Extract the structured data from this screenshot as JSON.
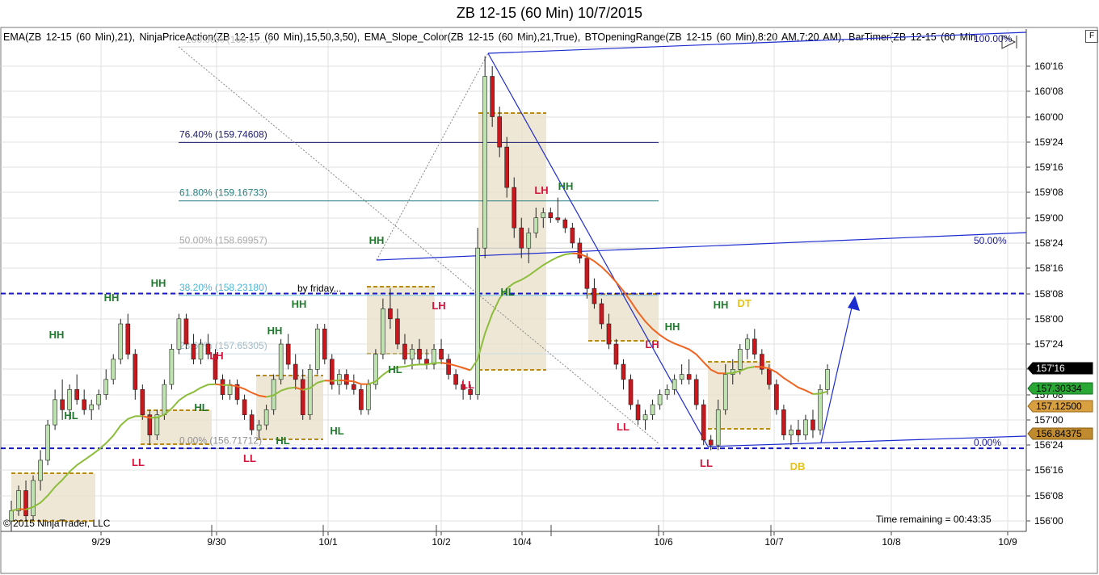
{
  "window": {
    "title": "ZB 12-15 (60 Min)  10/7/2015",
    "indicators_line": "EMA(ZB  12-15  (60  Min),21),  NinjaPriceAction(ZB  12-15  (60  Min),15,50,3,50),  EMA_Slope_Color(ZB  12-15  (60  Min),21,True),  BTOpeningRange(ZB  12-15  (60  Min),8:20  AM,7:20  AM),  BarTimer(ZB  12-15  (60  Min",
    "f_button": "F",
    "copyright": "© 2015 NinjaTrader, LLC",
    "time_remaining": "Time remaining = 00:43:35"
  },
  "colors": {
    "up_candle": "#bfe3b0",
    "down_candle": "#c8181e",
    "ema_green": "#8cbd3a",
    "ema_orange": "#ee6420",
    "channel_blue": "#1c2bd0",
    "dashed_level": "#1414c8",
    "range_fill": "#eadfc8",
    "range_border": "#b88a1a",
    "hh_label": "#1f7a2e",
    "ll_label": "#d4143c",
    "dt_label": "#e6c21a"
  },
  "chart_data": {
    "type": "candlestick",
    "symbol": "ZB 12-15",
    "interval": "60 Min",
    "y_range_ticks": [
      156.0,
      158.5625
    ],
    "x_ticks": [
      "9/29",
      "9/30",
      "10/1",
      "10/2",
      "10/4",
      "10/6",
      "10/7",
      "10/8",
      "10/9"
    ],
    "y_ticks": [
      "160'16",
      "160'08",
      "160'00",
      "159'24",
      "159'16",
      "159'08",
      "159'00",
      "158'24",
      "158'16",
      "158'08",
      "158'00",
      "157'24",
      "157'16",
      "157'08",
      "157'00",
      "156'24",
      "156'16",
      "156'08",
      "156'00"
    ],
    "price_badges": [
      {
        "label": "157'16",
        "style": "last"
      },
      {
        "label": "157.30334",
        "style": "ema"
      },
      {
        "label": "157.12500",
        "style": "range_high"
      },
      {
        "label": "156.84375",
        "style": "range_low"
      }
    ],
    "fibonacci_levels": [
      {
        "label": "76.40% (159.74608)",
        "value": 159.74608
      },
      {
        "label": "61.80% (159.16733)",
        "value": 159.16733
      },
      {
        "label": "50.00% (158.69957)",
        "value": 158.69957
      },
      {
        "label": "38.20% (158.23180)",
        "value": 158.2318
      },
      {
        "label": "23.60% (157.65305)",
        "value": 157.65305
      },
      {
        "label": "0.00% (156.71712)",
        "value": 156.71712
      },
      {
        "label": "100.00% (160.67...)",
        "value": 160.67
      }
    ],
    "channel_labels": [
      "100.00%",
      "50.00%",
      "0.00%"
    ],
    "dashed_levels": [
      158.25,
      156.71875
    ],
    "annotation": "by friday...",
    "swing_labels": [
      {
        "text": "HH",
        "kind": "hh"
      },
      {
        "text": "HL",
        "kind": "hh"
      },
      {
        "text": "LL",
        "kind": "ll"
      },
      {
        "text": "HH",
        "kind": "hh"
      },
      {
        "text": "HH",
        "kind": "hh"
      },
      {
        "text": "HL",
        "kind": "hh"
      },
      {
        "text": "LH",
        "kind": "ll"
      },
      {
        "text": "LL",
        "kind": "ll"
      },
      {
        "text": "HH",
        "kind": "hh"
      },
      {
        "text": "HH",
        "kind": "hh"
      },
      {
        "text": "HL",
        "kind": "hh"
      },
      {
        "text": "HL",
        "kind": "hh"
      },
      {
        "text": "HH",
        "kind": "hh"
      },
      {
        "text": "HL",
        "kind": "hh"
      },
      {
        "text": "LH",
        "kind": "ll"
      },
      {
        "text": "LL",
        "kind": "ll"
      },
      {
        "text": "LH",
        "kind": "ll"
      },
      {
        "text": "HH",
        "kind": "hh"
      },
      {
        "text": "HL",
        "kind": "hh"
      },
      {
        "text": "LL",
        "kind": "ll"
      },
      {
        "text": "HH",
        "kind": "hh"
      },
      {
        "text": "LH",
        "kind": "ll"
      },
      {
        "text": "LL",
        "kind": "ll"
      },
      {
        "text": "HH",
        "kind": "hh"
      },
      {
        "text": "DT",
        "kind": "dt"
      },
      {
        "text": "DB",
        "kind": "dt"
      }
    ],
    "candles": [
      {
        "o": 156.0,
        "h": 156.2,
        "l": 155.9,
        "c": 156.1
      },
      {
        "o": 156.1,
        "h": 156.35,
        "l": 156.05,
        "c": 156.3
      },
      {
        "o": 156.3,
        "h": 156.4,
        "l": 156.0,
        "c": 156.05
      },
      {
        "o": 156.05,
        "h": 156.45,
        "l": 156.0,
        "c": 156.4
      },
      {
        "o": 156.4,
        "h": 156.7,
        "l": 156.3,
        "c": 156.6
      },
      {
        "o": 156.6,
        "h": 157.0,
        "l": 156.55,
        "c": 156.95
      },
      {
        "o": 156.95,
        "h": 157.3,
        "l": 156.9,
        "c": 157.2
      },
      {
        "o": 157.2,
        "h": 157.4,
        "l": 157.0,
        "c": 157.1
      },
      {
        "o": 157.1,
        "h": 157.35,
        "l": 157.0,
        "c": 157.3
      },
      {
        "o": 157.3,
        "h": 157.45,
        "l": 157.15,
        "c": 157.2
      },
      {
        "o": 157.2,
        "h": 157.3,
        "l": 157.05,
        "c": 157.1
      },
      {
        "o": 157.1,
        "h": 157.2,
        "l": 157.0,
        "c": 157.15
      },
      {
        "o": 157.15,
        "h": 157.3,
        "l": 157.1,
        "c": 157.25
      },
      {
        "o": 157.25,
        "h": 157.5,
        "l": 157.2,
        "c": 157.4
      },
      {
        "o": 157.4,
        "h": 157.65,
        "l": 157.35,
        "c": 157.6
      },
      {
        "o": 157.6,
        "h": 158.0,
        "l": 157.55,
        "c": 157.95
      },
      {
        "o": 157.95,
        "h": 158.05,
        "l": 157.6,
        "c": 157.65
      },
      {
        "o": 157.65,
        "h": 157.7,
        "l": 157.2,
        "c": 157.3
      },
      {
        "o": 157.3,
        "h": 157.35,
        "l": 157.0,
        "c": 157.05
      },
      {
        "o": 157.05,
        "h": 157.1,
        "l": 156.75,
        "c": 156.85
      },
      {
        "o": 156.85,
        "h": 157.1,
        "l": 156.8,
        "c": 157.05
      },
      {
        "o": 157.05,
        "h": 157.4,
        "l": 157.0,
        "c": 157.35
      },
      {
        "o": 157.35,
        "h": 157.75,
        "l": 157.3,
        "c": 157.7
      },
      {
        "o": 157.7,
        "h": 158.05,
        "l": 157.65,
        "c": 158.0
      },
      {
        "o": 158.0,
        "h": 158.05,
        "l": 157.7,
        "c": 157.75
      },
      {
        "o": 157.75,
        "h": 157.85,
        "l": 157.55,
        "c": 157.6
      },
      {
        "o": 157.6,
        "h": 157.8,
        "l": 157.55,
        "c": 157.75
      },
      {
        "o": 157.75,
        "h": 157.85,
        "l": 157.6,
        "c": 157.65
      },
      {
        "o": 157.65,
        "h": 157.7,
        "l": 157.35,
        "c": 157.4
      },
      {
        "o": 157.4,
        "h": 157.45,
        "l": 157.2,
        "c": 157.25
      },
      {
        "o": 157.25,
        "h": 157.4,
        "l": 157.2,
        "c": 157.35
      },
      {
        "o": 157.35,
        "h": 157.4,
        "l": 157.15,
        "c": 157.2
      },
      {
        "o": 157.2,
        "h": 157.25,
        "l": 157.0,
        "c": 157.05
      },
      {
        "o": 157.05,
        "h": 157.1,
        "l": 156.85,
        "c": 156.9
      },
      {
        "o": 156.9,
        "h": 157.0,
        "l": 156.82,
        "c": 156.95
      },
      {
        "o": 156.95,
        "h": 157.15,
        "l": 156.9,
        "c": 157.1
      },
      {
        "o": 157.1,
        "h": 157.45,
        "l": 157.05,
        "c": 157.4
      },
      {
        "o": 157.4,
        "h": 157.8,
        "l": 157.35,
        "c": 157.75
      },
      {
        "o": 157.75,
        "h": 157.85,
        "l": 157.5,
        "c": 157.55
      },
      {
        "o": 157.55,
        "h": 157.65,
        "l": 157.3,
        "c": 157.4
      },
      {
        "o": 157.4,
        "h": 157.5,
        "l": 157.0,
        "c": 157.05
      },
      {
        "o": 157.05,
        "h": 157.55,
        "l": 157.0,
        "c": 157.5
      },
      {
        "o": 157.5,
        "h": 157.95,
        "l": 157.45,
        "c": 157.9
      },
      {
        "o": 157.9,
        "h": 157.95,
        "l": 157.55,
        "c": 157.6
      },
      {
        "o": 157.6,
        "h": 157.65,
        "l": 157.3,
        "c": 157.35
      },
      {
        "o": 157.35,
        "h": 157.5,
        "l": 157.25,
        "c": 157.45
      },
      {
        "o": 157.45,
        "h": 157.5,
        "l": 157.3,
        "c": 157.35
      },
      {
        "o": 157.35,
        "h": 157.45,
        "l": 157.25,
        "c": 157.3
      },
      {
        "o": 157.3,
        "h": 157.35,
        "l": 157.05,
        "c": 157.1
      },
      {
        "o": 157.1,
        "h": 157.4,
        "l": 157.05,
        "c": 157.35
      },
      {
        "o": 157.35,
        "h": 157.7,
        "l": 157.3,
        "c": 157.65
      },
      {
        "o": 157.65,
        "h": 158.2,
        "l": 157.6,
        "c": 158.1
      },
      {
        "o": 158.1,
        "h": 158.3,
        "l": 157.9,
        "c": 158.0
      },
      {
        "o": 158.0,
        "h": 158.1,
        "l": 157.7,
        "c": 157.75
      },
      {
        "o": 157.75,
        "h": 157.85,
        "l": 157.55,
        "c": 157.6
      },
      {
        "o": 157.6,
        "h": 157.75,
        "l": 157.5,
        "c": 157.7
      },
      {
        "o": 157.7,
        "h": 157.8,
        "l": 157.55,
        "c": 157.6
      },
      {
        "o": 157.6,
        "h": 157.7,
        "l": 157.5,
        "c": 157.55
      },
      {
        "o": 157.55,
        "h": 157.75,
        "l": 157.5,
        "c": 157.7
      },
      {
        "o": 157.7,
        "h": 157.8,
        "l": 157.55,
        "c": 157.6
      },
      {
        "o": 157.6,
        "h": 157.65,
        "l": 157.4,
        "c": 157.45
      },
      {
        "o": 157.45,
        "h": 157.5,
        "l": 157.3,
        "c": 157.35
      },
      {
        "o": 157.35,
        "h": 157.4,
        "l": 157.2,
        "c": 157.3
      },
      {
        "o": 157.3,
        "h": 157.35,
        "l": 157.2,
        "c": 157.25
      },
      {
        "o": 157.25,
        "h": 158.9,
        "l": 157.2,
        "c": 158.7
      },
      {
        "o": 158.7,
        "h": 160.6,
        "l": 158.6,
        "c": 160.4
      },
      {
        "o": 160.4,
        "h": 160.5,
        "l": 159.9,
        "c": 160.0
      },
      {
        "o": 160.0,
        "h": 160.1,
        "l": 159.6,
        "c": 159.7
      },
      {
        "o": 159.7,
        "h": 159.8,
        "l": 159.2,
        "c": 159.3
      },
      {
        "o": 159.3,
        "h": 159.4,
        "l": 158.8,
        "c": 158.9
      },
      {
        "o": 158.9,
        "h": 159.0,
        "l": 158.6,
        "c": 158.7
      },
      {
        "o": 158.7,
        "h": 158.9,
        "l": 158.55,
        "c": 158.85
      },
      {
        "o": 158.85,
        "h": 159.1,
        "l": 158.8,
        "c": 159.0
      },
      {
        "o": 159.0,
        "h": 159.1,
        "l": 158.9,
        "c": 159.05
      },
      {
        "o": 159.05,
        "h": 159.1,
        "l": 158.95,
        "c": 159.0
      },
      {
        "o": 159.0,
        "h": 159.2,
        "l": 158.95,
        "c": 158.98
      },
      {
        "o": 158.98,
        "h": 159.0,
        "l": 158.85,
        "c": 158.9
      },
      {
        "o": 158.9,
        "h": 158.95,
        "l": 158.7,
        "c": 158.75
      },
      {
        "o": 158.75,
        "h": 158.8,
        "l": 158.55,
        "c": 158.6
      },
      {
        "o": 158.6,
        "h": 158.65,
        "l": 158.2,
        "c": 158.3
      },
      {
        "o": 158.3,
        "h": 158.4,
        "l": 158.1,
        "c": 158.15
      },
      {
        "o": 158.15,
        "h": 158.2,
        "l": 157.9,
        "c": 157.95
      },
      {
        "o": 157.95,
        "h": 158.05,
        "l": 157.7,
        "c": 157.75
      },
      {
        "o": 157.75,
        "h": 157.8,
        "l": 157.5,
        "c": 157.55
      },
      {
        "o": 157.55,
        "h": 157.6,
        "l": 157.3,
        "c": 157.4
      },
      {
        "o": 157.4,
        "h": 157.45,
        "l": 157.1,
        "c": 157.15
      },
      {
        "o": 157.15,
        "h": 157.2,
        "l": 156.95,
        "c": 157.0
      },
      {
        "o": 157.0,
        "h": 157.1,
        "l": 156.9,
        "c": 157.05
      },
      {
        "o": 157.05,
        "h": 157.2,
        "l": 157.0,
        "c": 157.15
      },
      {
        "o": 157.15,
        "h": 157.3,
        "l": 157.1,
        "c": 157.25
      },
      {
        "o": 157.25,
        "h": 157.35,
        "l": 157.2,
        "c": 157.3
      },
      {
        "o": 157.3,
        "h": 157.45,
        "l": 157.25,
        "c": 157.4
      },
      {
        "o": 157.4,
        "h": 157.55,
        "l": 157.35,
        "c": 157.45
      },
      {
        "o": 157.45,
        "h": 157.6,
        "l": 157.35,
        "c": 157.4
      },
      {
        "o": 157.4,
        "h": 157.45,
        "l": 157.1,
        "c": 157.15
      },
      {
        "o": 157.15,
        "h": 157.2,
        "l": 156.75,
        "c": 156.8
      },
      {
        "o": 156.8,
        "h": 156.85,
        "l": 156.7,
        "c": 156.75
      },
      {
        "o": 156.75,
        "h": 157.2,
        "l": 156.7,
        "c": 157.1
      },
      {
        "o": 157.1,
        "h": 157.55,
        "l": 157.05,
        "c": 157.45
      },
      {
        "o": 157.45,
        "h": 157.6,
        "l": 157.35,
        "c": 157.5
      },
      {
        "o": 157.5,
        "h": 157.75,
        "l": 157.45,
        "c": 157.7
      },
      {
        "o": 157.7,
        "h": 157.85,
        "l": 157.6,
        "c": 157.8
      },
      {
        "o": 157.8,
        "h": 157.9,
        "l": 157.6,
        "c": 157.65
      },
      {
        "o": 157.65,
        "h": 157.7,
        "l": 157.45,
        "c": 157.5
      },
      {
        "o": 157.5,
        "h": 157.55,
        "l": 157.3,
        "c": 157.35
      },
      {
        "o": 157.35,
        "h": 157.4,
        "l": 157.05,
        "c": 157.1
      },
      {
        "o": 157.1,
        "h": 157.15,
        "l": 156.8,
        "c": 156.85
      },
      {
        "o": 156.85,
        "h": 156.95,
        "l": 156.75,
        "c": 156.9
      },
      {
        "o": 156.9,
        "h": 157.0,
        "l": 156.78,
        "c": 156.85
      },
      {
        "o": 156.85,
        "h": 157.05,
        "l": 156.8,
        "c": 157.0
      },
      {
        "o": 157.0,
        "h": 157.1,
        "l": 156.82,
        "c": 156.9
      },
      {
        "o": 156.9,
        "h": 157.35,
        "l": 156.85,
        "c": 157.3
      },
      {
        "o": 157.3,
        "h": 157.55,
        "l": 157.25,
        "c": 157.5
      }
    ]
  }
}
